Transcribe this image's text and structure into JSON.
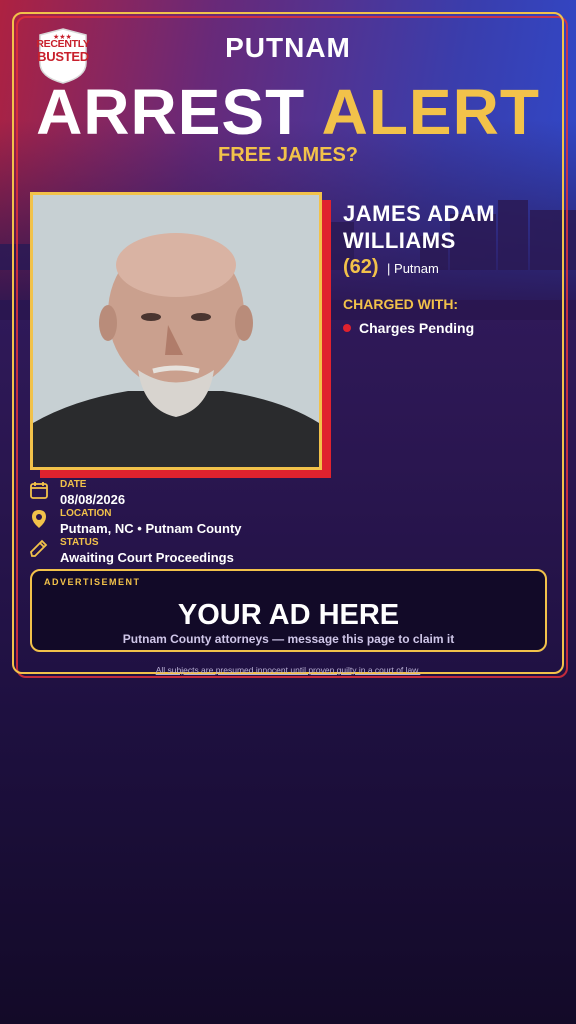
{
  "badge": {
    "line1": "RECENTLY",
    "line2": "BUSTED",
    "colors": {
      "fill": "#ffffff",
      "text": "#c8202c"
    }
  },
  "header": {
    "county": "PUTNAM",
    "headline_part1": "ARREST",
    "headline_part2": "ALERT",
    "subheadline": "FREE JAMES?"
  },
  "person": {
    "name_line1": "JAMES ADAM",
    "name_line2": "WILLIAMS",
    "age": "(62)",
    "location_short": "| Putnam",
    "charged_label": "CHARGED WITH:",
    "charges": [
      "Charges Pending"
    ]
  },
  "details": {
    "date_label": "DATE",
    "date_value": "08/08/2026",
    "location_label": "LOCATION",
    "location_value": "Putnam, NC • Putnam County",
    "status_label": "STATUS",
    "status_value": "Awaiting Court Proceedings"
  },
  "ad": {
    "tag": "ADVERTISEMENT",
    "title": "YOUR AD HERE",
    "subtitle": "Putnam County attorneys — message this page to claim it"
  },
  "footer": {
    "disclaimer": "All subjects are presumed innocent until proven guilty in a court of law."
  },
  "icons": [
    "calendar-icon",
    "location-pin-icon",
    "status-pen-icon",
    "stars-icon"
  ],
  "colors": {
    "accent": "#f2c24a",
    "alert_red": "#e0222e",
    "background": "#2a1650"
  }
}
